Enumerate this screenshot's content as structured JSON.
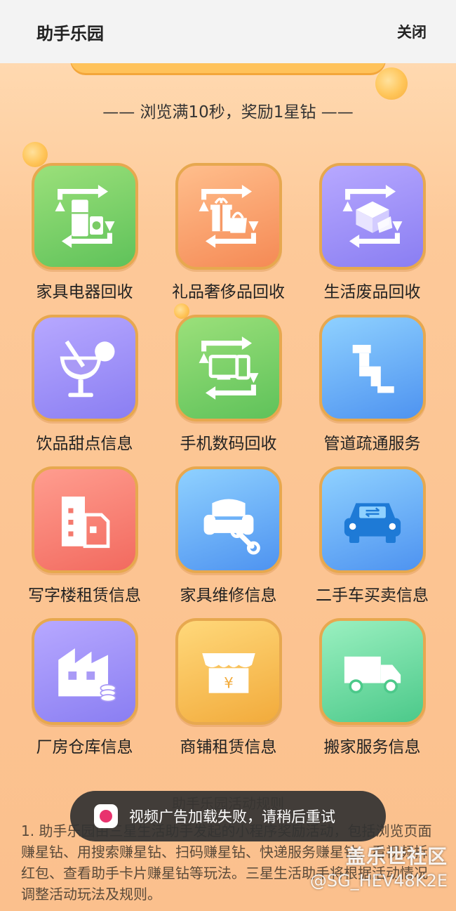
{
  "header": {
    "title": "助手乐园",
    "close_label": "关闭"
  },
  "banner": {
    "subtitle": "—— 浏览满10秒，奖励1星钻 ——"
  },
  "tiles": [
    {
      "label": "家具电器回收",
      "icon": "appliance-recycle-icon",
      "color": "green"
    },
    {
      "label": "礼品奢侈品回收",
      "icon": "gift-recycle-icon",
      "color": "orange"
    },
    {
      "label": "生活废品回收",
      "icon": "waste-recycle-icon",
      "color": "purple"
    },
    {
      "label": "饮品甜点信息",
      "icon": "drink-icon",
      "color": "purple"
    },
    {
      "label": "手机数码回收",
      "icon": "digital-recycle-icon",
      "color": "green"
    },
    {
      "label": "管道疏通服务",
      "icon": "pipe-icon",
      "color": "blue"
    },
    {
      "label": "写字楼租赁信息",
      "icon": "office-building-icon",
      "color": "red"
    },
    {
      "label": "家具维修信息",
      "icon": "sofa-repair-icon",
      "color": "blue"
    },
    {
      "label": "二手车买卖信息",
      "icon": "car-icon",
      "color": "blue"
    },
    {
      "label": "厂房仓库信息",
      "icon": "factory-icon",
      "color": "purple"
    },
    {
      "label": "商铺租赁信息",
      "icon": "shop-icon",
      "color": "gold"
    },
    {
      "label": "搬家服务信息",
      "icon": "truck-icon",
      "color": "mint"
    }
  ],
  "rules": {
    "title": "助手乐园活动规则",
    "text": "1. 助手乐园由三星生活助手发起的小程序奖励活动，包括浏览页面赚星钻、用搜索赚星钻、扫码赚星钻、快递服务赚星钻、看视频拆红包、查看助手卡片赚星钻等玩法。三星生活助手将根据活动情况调整活动玩法及规则。"
  },
  "toast": {
    "message": "视频广告加载失败，请稍后重试"
  },
  "watermark": {
    "line1": "盖乐世社区",
    "line2": "@SG_HEV48K2E"
  }
}
